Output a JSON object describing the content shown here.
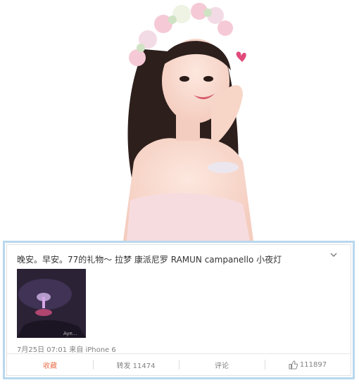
{
  "post": {
    "text": "晚安。早安。77的礼物～ 拉梦 康派尼罗 RAMUN campanello 小夜灯",
    "time": "7月25日 07:01",
    "source": "来自 iPhone 6",
    "thumb_watermark": "Aye..."
  },
  "actions": {
    "favorite": "收藏",
    "repost": "转发 11474",
    "comment": "评论",
    "like": "111897"
  },
  "icons": {
    "more": "chevron-down-icon",
    "like": "thumbs-up-icon"
  },
  "colors": {
    "card_border": "#b9d8ee",
    "favorite": "#eb7350",
    "meta": "#808080"
  }
}
